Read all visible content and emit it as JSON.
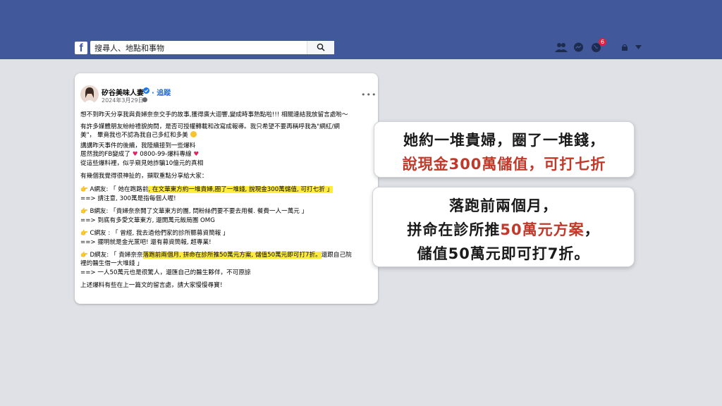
{
  "header": {
    "logo": "f",
    "search_placeholder": "搜尋人、地點和事物",
    "notification_count": "6",
    "colors": {
      "bar": "#41599a",
      "badge": "#e41e3f"
    }
  },
  "post": {
    "author": "矽谷美味人妻",
    "follow": "追蹤",
    "separator": "·",
    "date": "2024年3月29日 ·",
    "lines": [
      "想不到昨天分享我與貴婦奈奈交手的故事,獲得廣大迴響,變成時事熱點啦!!! 相關連結我放留言處喲～",
      "有許多媒體朋友紛紛禮貌詢問，是否可授權轉載和改寫成報導。我只希望不要再稱呼我為\"網紅/網",
      "美\"， 畢竟我也不認為我自己多紅和多美",
      "講講昨天事件的後續，我陸續接到一些爆料",
      "居然我的FB變成了",
      "0800-99-爆料專線",
      "從這些爆料裡，似乎窺見她詐騙10億元的真相",
      "有幾個我覺得很神扯的，擷取重點分享給大家："
    ],
    "items": [
      {
        "pre": "A網友: 「 她在跑路前",
        "hl": ", 在文華東方約一堆貴婦,圈了一堆錢, 說現金300萬儲值, 可打七折 」",
        "post": "",
        "reply": "==> 請注意, 300萬是指每個人喔!"
      },
      {
        "pre": "B網友: 「貴婦奈奈開了文華東方的團, 問粉絲們要不要去用餐. 餐費一人一萬元 」",
        "hl": "",
        "post": "",
        "reply": "==> 到底有多愛文華東方, 還開萬元飯局團 OMG"
      },
      {
        "pre": "C網友 : 「 曾經, 我去過他們家的診所聽募資簡報 」",
        "hl": "",
        "post": "",
        "reply": "==> 擺明就是金光黨吧! 還有募資簡報, 超專業!"
      },
      {
        "pre": "D網友: 「 貴婦奈奈",
        "hl": "落跑前兩個月, 拼命在診所推50萬元方案, 儲值50萬元即可打7折。",
        "post": "還跟自己院",
        "cont": "裡的醫生借一大堆錢 」",
        "reply": "==> 一人50萬元也是很驚人，還匯自己的醫生夥伴，不可原諒"
      }
    ],
    "closing": "上述爆料有些在上一篇文的留言處，請大家慢慢尋寶！"
  },
  "callout1": {
    "line1": "她約一堆貴婦，圈了一堆錢，",
    "line2": "說現金300萬儲值，可打七折"
  },
  "callout2": {
    "line1": "落跑前兩個月，",
    "line2_a": "拼命在診所推",
    "line2_b": "50萬元方案",
    "line2_c": "，",
    "line3": "儲值50萬元即可打7折。"
  }
}
